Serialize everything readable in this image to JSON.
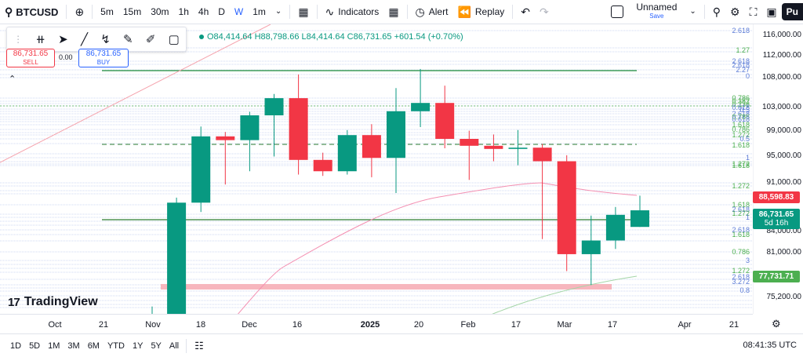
{
  "topbar": {
    "symbol": "BTCUSD",
    "intervals": [
      "5m",
      "15m",
      "30m",
      "1h",
      "4h",
      "D",
      "W",
      "1m"
    ],
    "active_interval": "W",
    "indicators_label": "Indicators",
    "alert_label": "Alert",
    "replay_label": "Replay",
    "layout_name": "Unnamed",
    "layout_save": "Save",
    "publish_label": "Pu"
  },
  "legend": {
    "open": "O84,414.64",
    "high": "H88,798.66",
    "low": "L84,414.64",
    "close": "C86,731.65",
    "change": "+601.54 (+0.70%)"
  },
  "trade": {
    "sell_price": "86,731.65",
    "sell_label": "SELL",
    "spread": "0.00",
    "buy_price": "86,731.65",
    "buy_label": "BUY"
  },
  "branding": {
    "logo_text": "TradingView"
  },
  "price_axis": {
    "labels": [
      "116,000.00",
      "112,000.00",
      "108,000.00",
      "103,000.00",
      "99,000.00",
      "95,000.00",
      "91,000.00",
      "84,000.00",
      "81,000.00",
      "75,200.00"
    ],
    "tags": [
      {
        "text": "88,598.83",
        "color": "#f23645"
      },
      {
        "text": "86,731.65",
        "sub": "5d 16h",
        "color": "#089981"
      },
      {
        "text": "77,731.71",
        "color": "#4caf50"
      }
    ]
  },
  "fib_labels": [
    "2.618",
    "1.27",
    "2.618",
    "2.618",
    "2.27",
    "0",
    "0.786",
    "0.382",
    "0.236",
    "0.618",
    "0.5",
    "2.618",
    "0.786",
    "0.618",
    "1.618",
    "0.786",
    "1.272",
    "0.5",
    "1.618",
    "1",
    "1.272",
    "1.618",
    "1.272",
    "1.618",
    "2.618",
    "1.272",
    "1",
    "2.618",
    "1.618",
    "0.786",
    "3",
    "1.272",
    "2.618",
    "3.272",
    "0.8"
  ],
  "time_axis": {
    "labels": [
      {
        "text": "Oct",
        "bold": false
      },
      {
        "text": "21",
        "bold": false
      },
      {
        "text": "Nov",
        "bold": false
      },
      {
        "text": "18",
        "bold": false
      },
      {
        "text": "Dec",
        "bold": false
      },
      {
        "text": "16",
        "bold": false
      },
      {
        "text": "2025",
        "bold": true
      },
      {
        "text": "20",
        "bold": false
      },
      {
        "text": "Feb",
        "bold": false
      },
      {
        "text": "17",
        "bold": false
      },
      {
        "text": "Mar",
        "bold": false
      },
      {
        "text": "17",
        "bold": false
      },
      {
        "text": "Apr",
        "bold": false
      },
      {
        "text": "21",
        "bold": false
      }
    ]
  },
  "bottombar": {
    "ranges": [
      "1D",
      "5D",
      "1M",
      "3M",
      "6M",
      "YTD",
      "1Y",
      "5Y",
      "All"
    ],
    "clock": "08:41:35 UTC"
  },
  "colors": {
    "up": "#089981",
    "down": "#f23645",
    "accent": "#2962ff"
  },
  "chart_data": {
    "type": "candlestick",
    "interval": "W",
    "candles": [
      {
        "o": 68500,
        "h": 73500,
        "l": 66800,
        "c": 72300
      },
      {
        "o": 72300,
        "h": 88500,
        "l": 71600,
        "c": 87800
      },
      {
        "o": 87800,
        "h": 99500,
        "l": 86500,
        "c": 97900
      },
      {
        "o": 97900,
        "h": 98600,
        "l": 90500,
        "c": 97300
      },
      {
        "o": 97300,
        "h": 102000,
        "l": 92500,
        "c": 101400
      },
      {
        "o": 101400,
        "h": 105000,
        "l": 94700,
        "c": 104300
      },
      {
        "o": 104300,
        "h": 108300,
        "l": 92000,
        "c": 94200
      },
      {
        "o": 94200,
        "h": 95300,
        "l": 91800,
        "c": 92500
      },
      {
        "o": 92500,
        "h": 98900,
        "l": 92000,
        "c": 98100
      },
      {
        "o": 98100,
        "h": 99900,
        "l": 91600,
        "c": 94500
      },
      {
        "o": 94500,
        "h": 106000,
        "l": 89200,
        "c": 102100
      },
      {
        "o": 102100,
        "h": 109300,
        "l": 99400,
        "c": 103500
      },
      {
        "o": 103500,
        "h": 106400,
        "l": 96000,
        "c": 97500
      },
      {
        "o": 97500,
        "h": 98800,
        "l": 91200,
        "c": 96400
      },
      {
        "o": 96400,
        "h": 98200,
        "l": 94000,
        "c": 95900
      },
      {
        "o": 95900,
        "h": 98900,
        "l": 93400,
        "c": 96100
      },
      {
        "o": 96100,
        "h": 96700,
        "l": 82700,
        "c": 94000
      },
      {
        "o": 94000,
        "h": 94900,
        "l": 78400,
        "c": 80600
      },
      {
        "o": 80600,
        "h": 86000,
        "l": 76600,
        "c": 82500
      },
      {
        "o": 82500,
        "h": 87200,
        "l": 81300,
        "c": 86100
      },
      {
        "o": 84414.64,
        "h": 88798.66,
        "l": 84414.64,
        "c": 86731.65
      }
    ]
  }
}
